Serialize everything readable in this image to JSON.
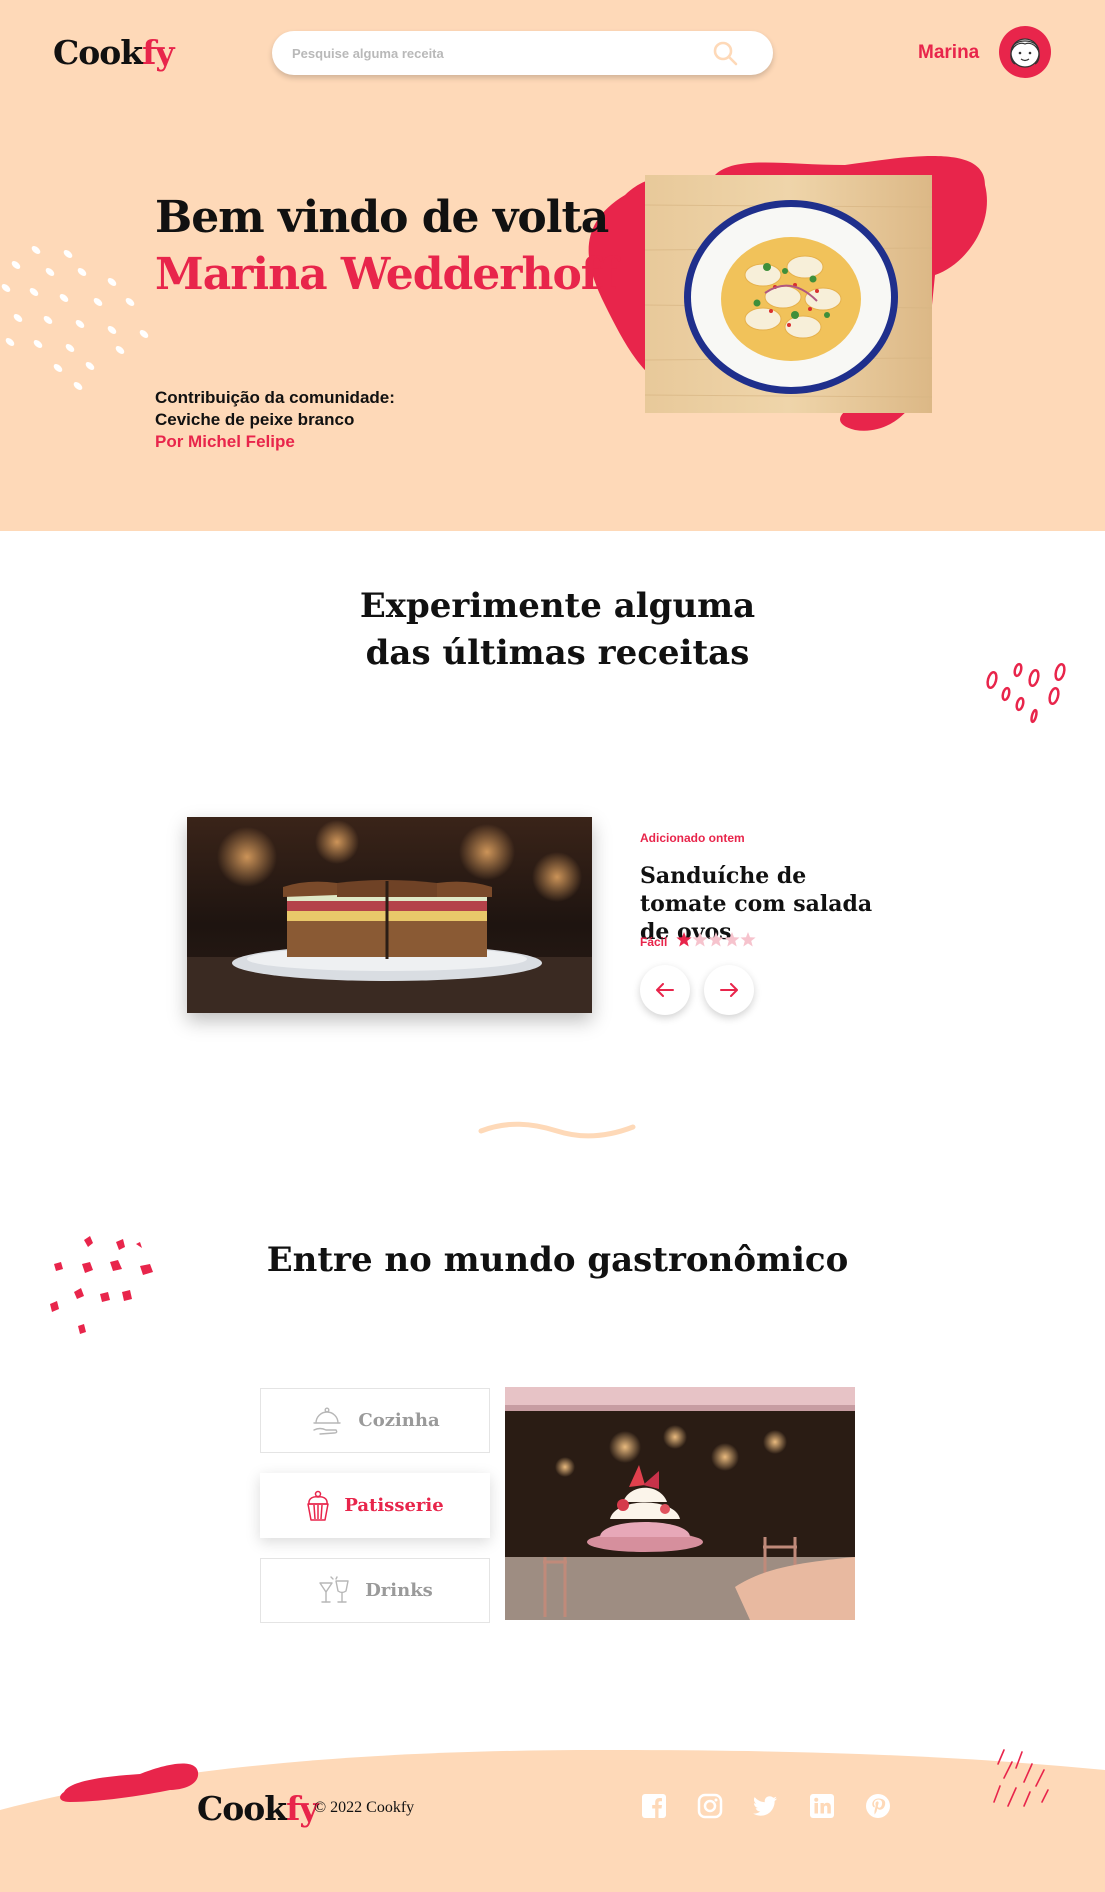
{
  "header": {
    "logo": {
      "part1": "Cook",
      "part2": "fy"
    },
    "search": {
      "placeholder": "Pesquise alguma receita"
    },
    "user": {
      "name": "Marina"
    }
  },
  "hero": {
    "greeting": "Bem vindo de volta",
    "user_full_name": "Marina Wedderhoff",
    "contribution": {
      "label": "Contribuição da comunidade:",
      "recipe": "Ceviche de peixe branco",
      "author": "Por Michel Felipe"
    }
  },
  "latest": {
    "title_line1": "Experimente alguma",
    "title_line2": "das últimas receitas",
    "card": {
      "added": "Adicionado ontem",
      "name": "Sanduíche de tomate com salada de ovos",
      "difficulty": "Fácil",
      "rating": 1,
      "rating_max": 5
    }
  },
  "world": {
    "title": "Entre no mundo gastronômico",
    "categories": [
      {
        "label": "Cozinha",
        "icon": "serving-cloche-icon",
        "active": false
      },
      {
        "label": "Patisserie",
        "icon": "cupcake-icon",
        "active": true
      },
      {
        "label": "Drinks",
        "icon": "cocktail-glasses-icon",
        "active": false
      }
    ]
  },
  "footer": {
    "logo": {
      "part1": "Cook",
      "part2": "fy"
    },
    "copyright": "© 2022 Cookfy",
    "social": [
      "facebook-icon",
      "instagram-icon",
      "twitter-icon",
      "linkedin-icon",
      "pinterest-icon"
    ]
  },
  "colors": {
    "accent": "#e8254b",
    "peach": "#fed9b8",
    "text": "#111111",
    "muted": "#9a9a9a"
  }
}
